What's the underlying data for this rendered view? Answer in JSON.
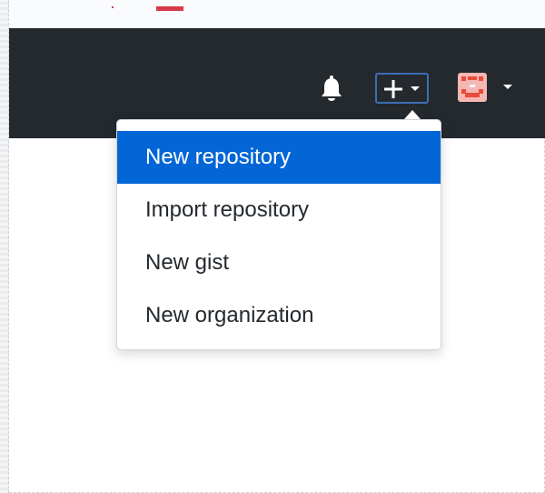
{
  "header": {
    "background": "#24292e",
    "notifications": {
      "icon": "bell-icon"
    },
    "create_menu_button": {
      "icon": "plus-icon",
      "caret_icon": "caret-down-icon",
      "border_color": "#3c6fb4"
    },
    "user_menu_button": {
      "icon": "identicon-avatar",
      "caret_icon": "caret-down-icon"
    }
  },
  "create_menu": {
    "items": [
      {
        "label": "New repository",
        "highlighted": true
      },
      {
        "label": "Import repository",
        "highlighted": false
      },
      {
        "label": "New gist",
        "highlighted": false
      },
      {
        "label": "New organization",
        "highlighted": false
      }
    ],
    "highlight_color": "#0366d6"
  },
  "colors": {
    "accent_red": "#d73a49",
    "avatar_tile": "#f5b7b1",
    "avatar_face": "#e74c3c"
  }
}
